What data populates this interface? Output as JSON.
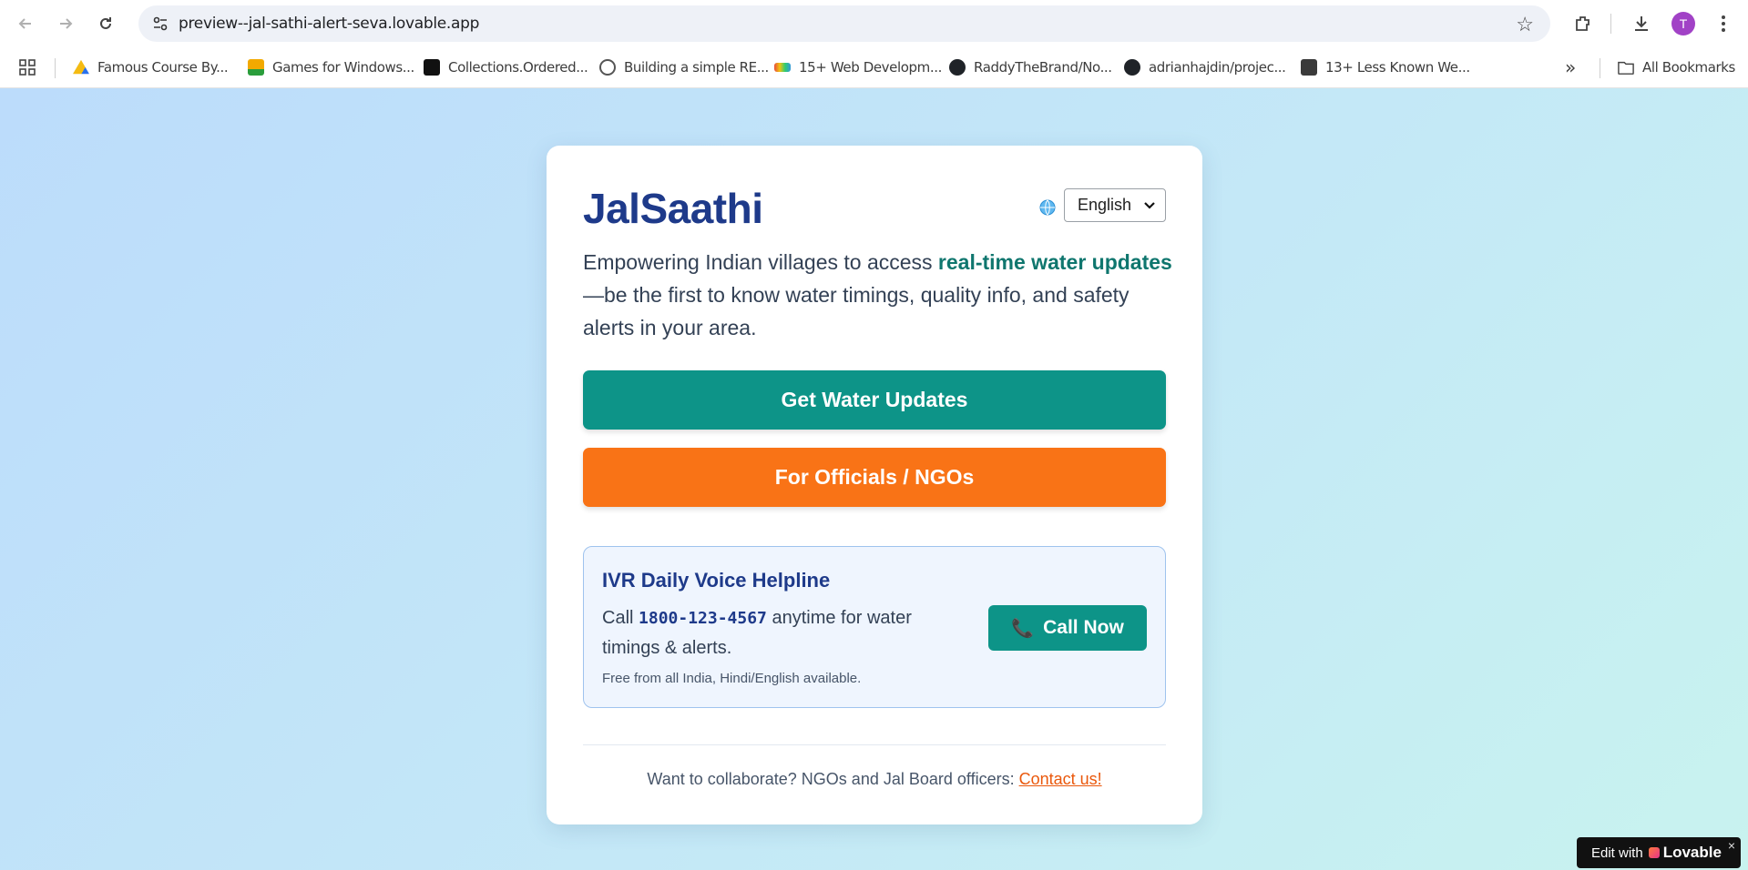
{
  "browser": {
    "url": "preview--jal-sathi-alert-seva.lovable.app",
    "profile_initial": "T",
    "bookmarks": [
      {
        "label": "Famous Course By..."
      },
      {
        "label": "Games for Windows..."
      },
      {
        "label": "Collections.Ordered..."
      },
      {
        "label": "Building a simple RE..."
      },
      {
        "label": "15+ Web Developm..."
      },
      {
        "label": "RaddyTheBrand/No..."
      },
      {
        "label": "adrianhajdin/projec..."
      },
      {
        "label": "13+ Less Known We..."
      }
    ],
    "overflow": "»",
    "all_bookmarks": "All Bookmarks"
  },
  "app": {
    "brand": "JalSaathi",
    "language": {
      "selected": "English"
    },
    "lead": {
      "before": "Empowering Indian villages to access ",
      "highlight": "real-time water updates",
      "after": "—be the first to know water timings, quality info, and safety alerts in your area."
    },
    "primary_button": "Get Water Updates",
    "secondary_button": "For Officials / NGOs",
    "ivr": {
      "title": "IVR Daily Voice Helpline",
      "text_before": "Call ",
      "number": "1800-123-4567",
      "text_after": " anytime for water timings & alerts.",
      "note": "Free from all India, Hindi/English available.",
      "call_button": "Call Now"
    },
    "footer": {
      "text": "Want to collaborate? NGOs and Jal Board officers: ",
      "link": "Contact us!"
    }
  },
  "badge": {
    "prefix": "Edit with",
    "brand": "Lovable",
    "close": "×"
  },
  "colors": {
    "brand_blue": "#1e3a8a",
    "teal": "#0d9488",
    "orange": "#f97316"
  }
}
